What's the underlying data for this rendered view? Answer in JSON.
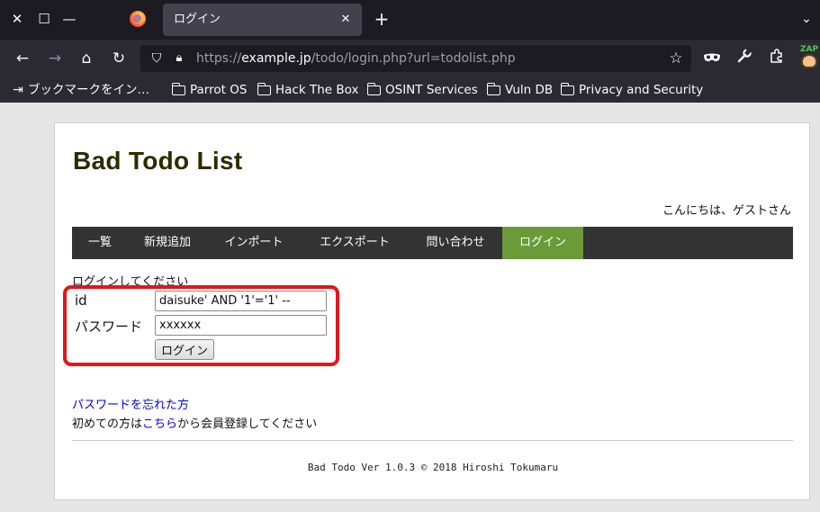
{
  "browser": {
    "tab": {
      "title": "ログイン"
    },
    "url": {
      "scheme": "https://",
      "host": "example.jp",
      "path": "/todo/login.php?url=todolist.php"
    },
    "bookmarks": [
      {
        "label": "ブックマークをイン…",
        "icon": "import-icon"
      },
      {
        "label": "Parrot OS",
        "icon": "folder-icon"
      },
      {
        "label": "Hack The Box",
        "icon": "folder-icon"
      },
      {
        "label": "OSINT Services",
        "icon": "folder-icon"
      },
      {
        "label": "Vuln DB",
        "icon": "folder-icon"
      },
      {
        "label": "Privacy and Security",
        "icon": "folder-icon"
      }
    ],
    "extension_label": "ZAP",
    "colors": {
      "tabbar": "#1c1b22",
      "toolbar": "#2b2a33",
      "active_tab": "#42414d"
    }
  },
  "page": {
    "site_title": "Bad Todo List",
    "greeting": "こんにちは、ゲストさん",
    "menu": [
      {
        "label": "一覧",
        "active": false
      },
      {
        "label": "新規追加",
        "active": false
      },
      {
        "label": "インポート",
        "active": false
      },
      {
        "label": "エクスポート",
        "active": false
      },
      {
        "label": "問い合わせ",
        "active": false
      },
      {
        "label": "ログイン",
        "active": true
      }
    ],
    "login": {
      "prompt": "ログインしてください",
      "id_label": "id",
      "id_value": "daisuke' AND '1'='1' --",
      "password_label": "パスワード",
      "password_value": "xxxxxx",
      "button_label": "ログイン"
    },
    "forgot_password": "パスワードを忘れた方",
    "signup": {
      "prefix": "初めての方は",
      "link": "こちら",
      "suffix": "から会員登録してください"
    },
    "footer": "Bad Todo Ver 1.0.3 © 2018 Hiroshi Tokumaru",
    "colors": {
      "menu_bg": "#333333",
      "menu_active": "#6a9b38",
      "title": "#2e2a00",
      "highlight": "#e3151b",
      "link": "#0000ee"
    }
  }
}
